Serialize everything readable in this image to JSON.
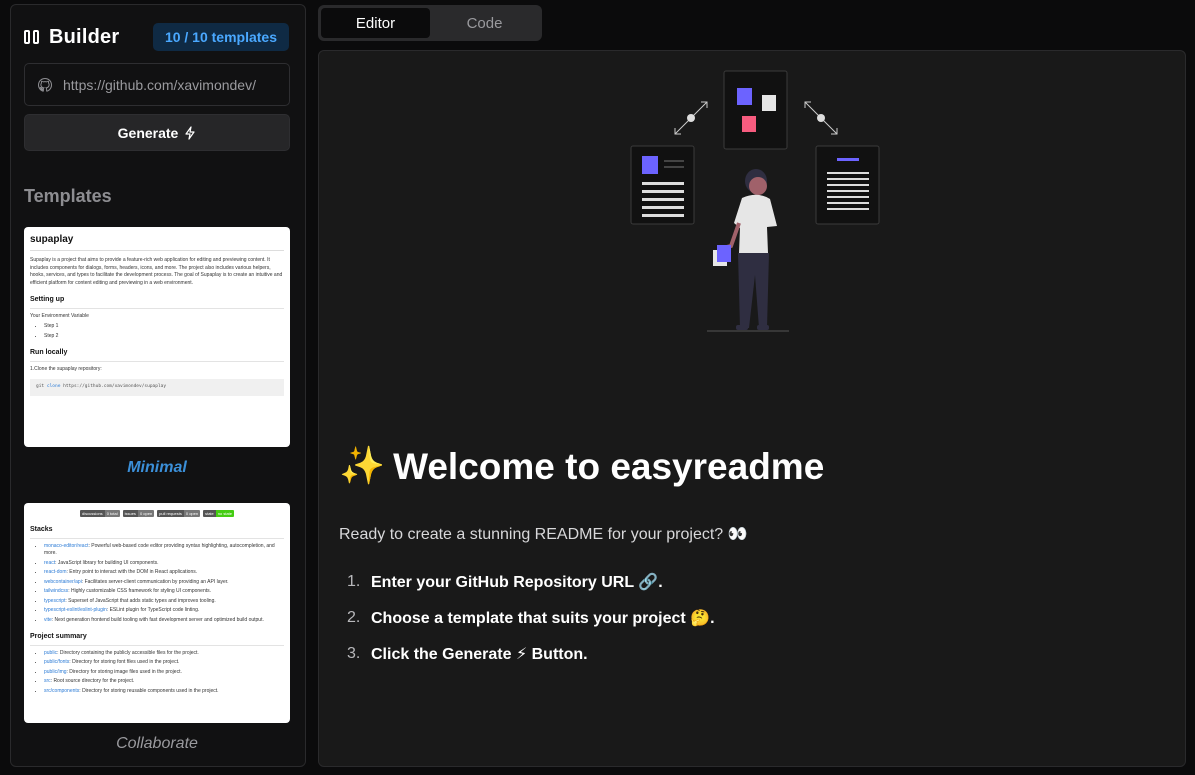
{
  "sidebar": {
    "title": "Builder",
    "template_count": "10 / 10 templates",
    "repo_input": {
      "value": "https://github.com/xavimondev/",
      "placeholder": "https://github.com/xavimondev/"
    },
    "generate_label": "Generate",
    "generate_icon": "⚡",
    "templates_heading": "Templates",
    "templates": [
      {
        "label": "Minimal",
        "preview": {
          "title": "supaplay",
          "intro": "Supaplay is a project that aims to provide a feature-rich web application for editing and previewing content. It includes components for dialogs, forms, headers, icons, and more. The project also includes various helpers, hooks, services, and types to facilitate the development process. The goal of Supaplay is to create an intuitive and efficient platform for content editing and previewing in a web environment.",
          "setup_heading": "Setting up",
          "env_label": "Your Environment Variable",
          "steps": [
            "Step 1",
            "Step 2"
          ],
          "run_heading": "Run locally",
          "clone_label": "1.Clone the supaplay repository:",
          "code_cmd": "git",
          "code_sub": "clone",
          "code_url": "https://github.com/xavimondev/supaplay"
        }
      },
      {
        "label": "Collaborate",
        "preview": {
          "shields": [
            {
              "k": "discussions",
              "v": "0 total"
            },
            {
              "k": "issues",
              "v": "0 open"
            },
            {
              "k": "pull requests",
              "v": "0 open"
            },
            {
              "k": "state",
              "v": "no state"
            }
          ],
          "stacks_heading": "Stacks",
          "stacks": [
            {
              "name": "monaco-editor/react",
              "desc": ": Powerful web-based code editor providing syntax highlighting, autocompletion, and more."
            },
            {
              "name": "react",
              "desc": ": JavaScript library for building UI components."
            },
            {
              "name": "react-dom",
              "desc": ": Entry point to interact with the DOM in React applications."
            },
            {
              "name": "webcontainer/api",
              "desc": ": Facilitates server-client communication by providing an API layer."
            },
            {
              "name": "tailwindcss",
              "desc": ": Highly customizable CSS framework for styling UI components."
            },
            {
              "name": "typescript",
              "desc": ": Superset of JavaScript that adds static types and improves tooling."
            },
            {
              "name": "typescript-eslint/eslint-plugin",
              "desc": ": ESLint plugin for TypeScript code linting."
            },
            {
              "name": "vite",
              "desc": ": Next generation frontend build tooling with fast development server and optimized build output."
            }
          ],
          "summary_heading": "Project summary",
          "summary": [
            {
              "name": "public",
              "desc": ": Directory containing the publicly accessible files for the project."
            },
            {
              "name": "public/fonts",
              "desc": ": Directory for storing font files used in the project."
            },
            {
              "name": "public/img",
              "desc": ": Directory for storing image files used in the project."
            },
            {
              "name": "src",
              "desc": ": Root source directory for the project."
            },
            {
              "name": "src/components",
              "desc": ": Directory for storing reusable components used in the project."
            }
          ]
        }
      }
    ]
  },
  "tabs": [
    {
      "label": "Editor",
      "active": true
    },
    {
      "label": "Code",
      "active": false
    }
  ],
  "main": {
    "welcome_emoji": "✨",
    "welcome_title": "Welcome to easyreadme",
    "intro": "Ready to create a stunning README for your project? 👀",
    "steps": [
      {
        "num": "1.",
        "text": "Enter your GitHub Repository URL 🔗."
      },
      {
        "num": "2.",
        "text": "Choose a template that suits your project 🤔."
      },
      {
        "num": "3.",
        "text": "Click the Generate ⚡ Button."
      }
    ]
  },
  "colors": {
    "background": "#0b0b0c",
    "panel": "#191919",
    "accent_blue": "#4aa8ff",
    "badge_bg": "#0f2a44",
    "illustration_purple": "#6c63ff",
    "illustration_pink": "#f75c7f"
  },
  "icons": [
    "columns-icon",
    "github-icon",
    "lightning-icon"
  ]
}
